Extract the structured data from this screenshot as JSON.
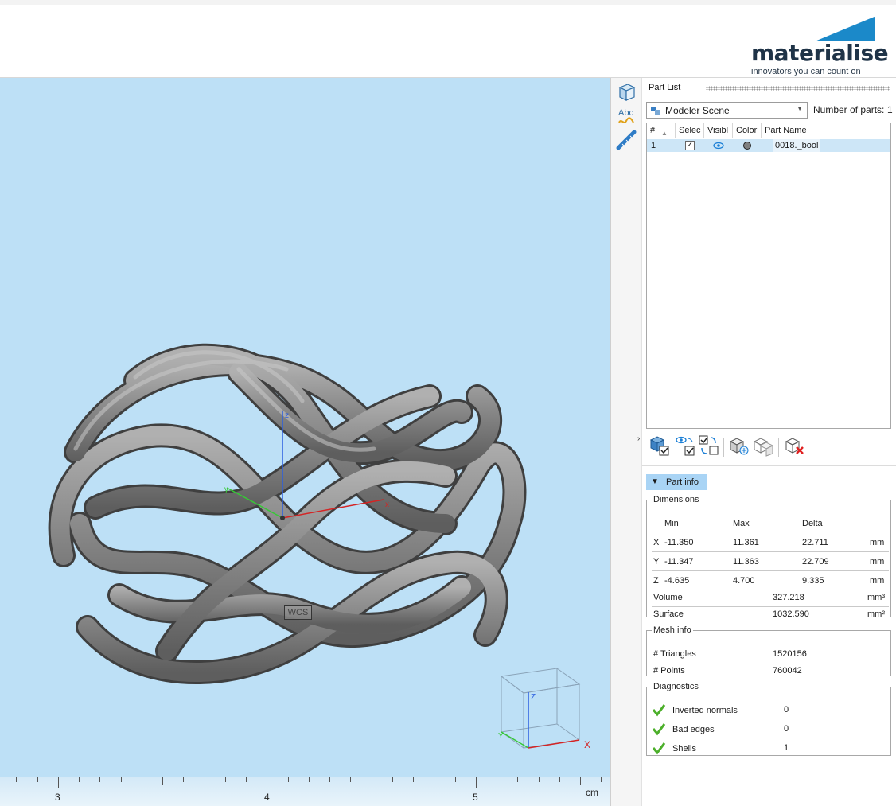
{
  "brand": {
    "name": "materialise",
    "tagline": "innovators you can count on",
    "accent": "#1b89c9",
    "dark": "#1f3347"
  },
  "viewport": {
    "background": "#bde0f6",
    "axes": {
      "z": "z",
      "x": "x",
      "y": "y"
    },
    "wcs_label": "WCS",
    "cube_axes": {
      "z": "Z",
      "x": "X",
      "y": "Y"
    }
  },
  "ruler": {
    "labels": [
      "3",
      "4",
      "5"
    ],
    "unit": "cm"
  },
  "tools": [
    "view-cube-icon",
    "text-annotation-icon",
    "measure-ruler-icon"
  ],
  "part_list": {
    "title": "Part List",
    "scene": "Modeler Scene",
    "num_parts_label": "Number of parts:",
    "num_parts": "1",
    "columns": [
      "#",
      "Selec",
      "Visibl",
      "Color",
      "Part Name"
    ],
    "rows": [
      {
        "num": "1",
        "selected": true,
        "visible": true,
        "color": "#808080",
        "name": "0018._bool"
      }
    ],
    "actions": [
      "select-all-icon",
      "toggle-visibility-icon",
      "invert-selection-icon",
      "duplicate-part-icon",
      "wireframe-part-icon",
      "delete-part-icon"
    ]
  },
  "part_info": {
    "header": "Part info",
    "dimensions": {
      "title": "Dimensions",
      "col_min": "Min",
      "col_max": "Max",
      "col_delta": "Delta",
      "rows": [
        {
          "axis": "X",
          "min": "-11.350",
          "max": "11.361",
          "delta": "22.711",
          "unit": "mm"
        },
        {
          "axis": "Y",
          "min": "-11.347",
          "max": "11.363",
          "delta": "22.709",
          "unit": "mm"
        },
        {
          "axis": "Z",
          "min": "-4.635",
          "max": "4.700",
          "delta": "9.335",
          "unit": "mm"
        }
      ],
      "volume_label": "Volume",
      "volume": "327.218",
      "volume_unit": "mm³",
      "surface_label": "Surface",
      "surface": "1032.590",
      "surface_unit": "mm²"
    },
    "mesh": {
      "title": "Mesh info",
      "triangles_label": "# Triangles",
      "triangles": "1520156",
      "points_label": "# Points",
      "points": "760042"
    },
    "diagnostics": {
      "title": "Diagnostics",
      "items": [
        {
          "label": "Inverted normals",
          "value": "0"
        },
        {
          "label": "Bad edges",
          "value": "0"
        },
        {
          "label": "Shells",
          "value": "1"
        }
      ]
    }
  }
}
